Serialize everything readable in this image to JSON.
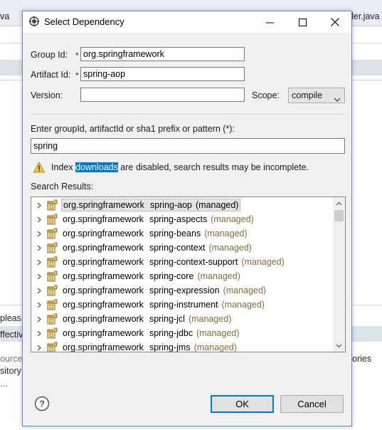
{
  "background": {
    "tab_left": "va",
    "tab_right": "ler.java",
    "text_please": "pleas",
    "text_effective": "ffectiv",
    "text_source": "ource",
    "text_ories": "ories",
    "text_sitory": "sitory",
    "text_ellipsis": "..."
  },
  "dialog": {
    "title": "Select Dependency",
    "group_id_label": "Group Id:",
    "group_id_value": "org.springframework",
    "artifact_id_label": "Artifact Id:",
    "artifact_id_value": "spring-aop",
    "required_marker": "*",
    "version_label": "Version:",
    "version_value": "",
    "scope_label": "Scope:",
    "scope_value": "compile",
    "search_prompt": "Enter groupId, artifactId or sha1 prefix or pattern (*):",
    "search_value": "spring",
    "warning_prefix": "Index ",
    "warning_highlight": "downloads",
    "warning_suffix": " are disabled, search results may be incomplete.",
    "results_label": "Search Results:",
    "results": [
      {
        "group": "org.springframework",
        "artifact": "spring-aop",
        "tag": "(managed)"
      },
      {
        "group": "org.springframework",
        "artifact": "spring-aspects",
        "tag": "(managed)"
      },
      {
        "group": "org.springframework",
        "artifact": "spring-beans",
        "tag": "(managed)"
      },
      {
        "group": "org.springframework",
        "artifact": "spring-context",
        "tag": "(managed)"
      },
      {
        "group": "org.springframework",
        "artifact": "spring-context-support",
        "tag": "(managed)"
      },
      {
        "group": "org.springframework",
        "artifact": "spring-core",
        "tag": "(managed)"
      },
      {
        "group": "org.springframework",
        "artifact": "spring-expression",
        "tag": "(managed)"
      },
      {
        "group": "org.springframework",
        "artifact": "spring-instrument",
        "tag": "(managed)"
      },
      {
        "group": "org.springframework",
        "artifact": "spring-jcl",
        "tag": "(managed)"
      },
      {
        "group": "org.springframework",
        "artifact": "spring-jdbc",
        "tag": "(managed)"
      },
      {
        "group": "org.springframework",
        "artifact": "spring-jms",
        "tag": "(managed)"
      }
    ],
    "selected_index": 0,
    "ok_label": "OK",
    "cancel_label": "Cancel"
  },
  "icons": {
    "title": "eclipse-dialog-icon",
    "minimize": "minimize-icon",
    "maximize": "maximize-icon",
    "close": "close-icon",
    "warning": "warning-triangle-icon",
    "expand": "chevron-right-icon",
    "artifact": "jar-icon",
    "help": "help-icon"
  },
  "colors": {
    "accent": "#0078d7",
    "managed_text": "#8a6a35",
    "dialog_border": "#5b8ed6"
  }
}
